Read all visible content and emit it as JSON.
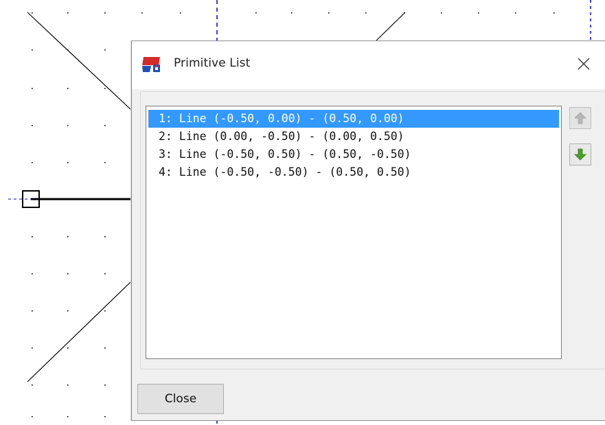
{
  "dialog": {
    "title": "Primitive List",
    "close_button_label": "Close"
  },
  "primitive_list": {
    "selected_index": 0,
    "items": [
      "1: Line (-0.50, 0.00) - (0.50, 0.00)",
      "2: Line (0.00, -0.50) - (0.00, 0.50)",
      "3: Line (-0.50, 0.50) - (0.50, -0.50)",
      "4: Line (-0.50, -0.50) - (0.50, 0.50)"
    ]
  },
  "icons": {
    "app": "primitive-editor-icon",
    "close": "close-icon",
    "move_up": "arrow-up-icon",
    "move_down": "arrow-down-icon"
  },
  "colors": {
    "selection": "#3399ff",
    "axis_line": "#0000cc",
    "move_down_arrow": "#4aa02c",
    "move_up_arrow": "#b8b8b8",
    "app_icon_red": "#d42a2a",
    "app_icon_blue": "#1f4fbf"
  }
}
